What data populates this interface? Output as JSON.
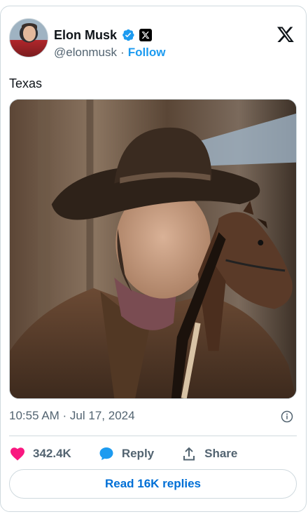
{
  "author": {
    "name": "Elon Musk",
    "handle": "@elonmusk",
    "separator": "·",
    "follow_label": "Follow",
    "verified": true,
    "avatar_icon": "avatar-photo",
    "affiliation_icon": "x-badge-icon"
  },
  "platform_logo": "x-logo",
  "tweet": {
    "text": "Texas",
    "image_alt_icon": "cowboy-photo",
    "timestamp": "10:55 AM · Jul 17, 2024"
  },
  "actions": {
    "likes_count": "342.4K",
    "reply_label": "Reply",
    "share_label": "Share"
  },
  "read_replies_label": "Read 16K replies",
  "colors": {
    "accent": "#1d9bf0",
    "like": "#f91880",
    "text_secondary": "#536471",
    "read_button_text": "#006fd6"
  }
}
